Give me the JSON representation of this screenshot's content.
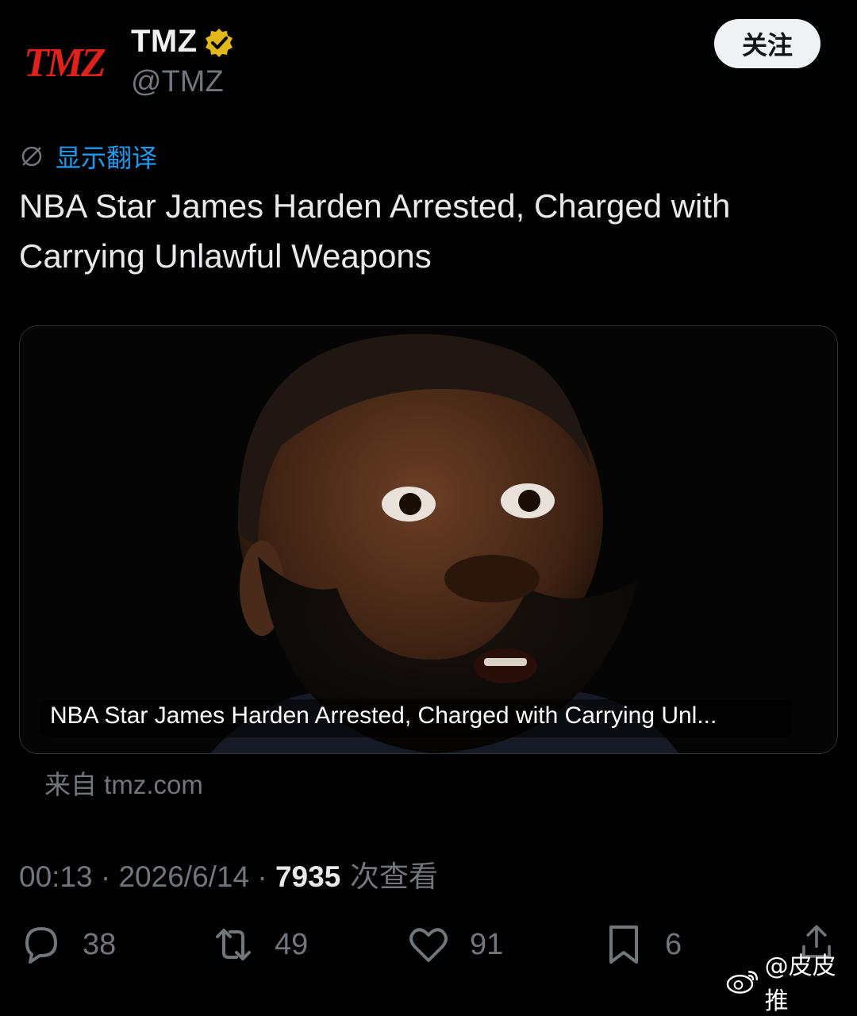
{
  "header": {
    "logo_text": "TMZ",
    "display_name": "TMZ",
    "handle": "@TMZ",
    "follow_label": "关注",
    "verified_icon": "verified-badge-icon",
    "brand_color": "#e0201b",
    "verified_color": "#e2b719"
  },
  "translate": {
    "label": "显示翻译",
    "icon": "translate-icon",
    "color": "#1d9bf0"
  },
  "tweet": {
    "line1": "NBA Star James Harden Arrested, Charged with",
    "line2": "Carrying Unlawful Weapons"
  },
  "card": {
    "title": "NBA Star James Harden Arrested, Charged with Carrying Unl...",
    "source": "来自 tmz.com"
  },
  "meta": {
    "time": "00:13",
    "sep1": " · ",
    "date": "2026/6/14",
    "sep2": " · ",
    "views": "7935",
    "views_label": " 次查看"
  },
  "actions": {
    "reply": {
      "icon": "reply-icon",
      "count": "38"
    },
    "retweet": {
      "icon": "retweet-icon",
      "count": "49"
    },
    "like": {
      "icon": "heart-icon",
      "count": "91"
    },
    "bookmark": {
      "icon": "bookmark-icon",
      "count": "6"
    },
    "share": {
      "icon": "share-icon"
    }
  },
  "watermark": {
    "text": "@皮皮推",
    "icon": "weibo-icon"
  }
}
